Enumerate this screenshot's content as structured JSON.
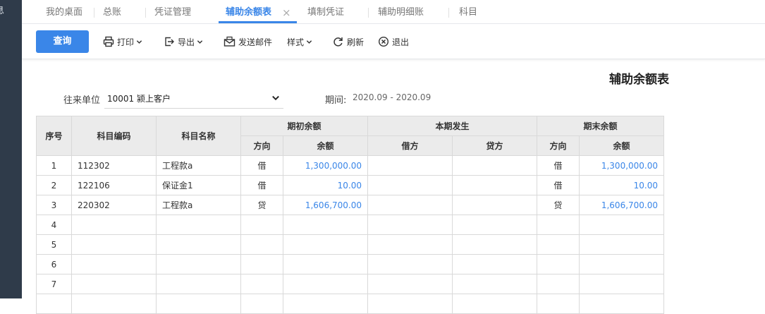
{
  "sidebar": {
    "glyph": "息"
  },
  "tabs": [
    {
      "label": "我的桌面",
      "active": false
    },
    {
      "label": "总账",
      "active": false
    },
    {
      "label": "凭证管理",
      "active": false
    },
    {
      "label": "辅助余额表",
      "active": true,
      "closable": true
    },
    {
      "label": "填制凭证",
      "active": false
    },
    {
      "label": "辅助明细账",
      "active": false
    },
    {
      "label": "科目",
      "active": false
    }
  ],
  "tab_close_glyph": "×",
  "toolbar": {
    "query_label": "查询",
    "print_label": "打印",
    "export_label": "导出",
    "email_label": "发送邮件",
    "style_label": "样式",
    "refresh_label": "刷新",
    "exit_label": "退出"
  },
  "report": {
    "title": "辅助余额表",
    "unit_label": "往来单位",
    "unit_value": "10001 颍上客户",
    "period_label": "期间:",
    "period_value": "2020.09 - 2020.09"
  },
  "table": {
    "headers": {
      "seq": "序号",
      "code": "科目编码",
      "name": "科目名称",
      "opening": "期初余额",
      "current": "本期发生",
      "closing": "期末余额",
      "direction": "方向",
      "balance": "余额",
      "debit": "借方",
      "credit": "贷方"
    },
    "rows": [
      {
        "seq": "1",
        "code": "112302",
        "name": "工程款a",
        "open_dir": "借",
        "open_bal": "1,300,000.00",
        "debit": "",
        "credit": "",
        "close_dir": "借",
        "close_bal": "1,300,000.00"
      },
      {
        "seq": "2",
        "code": "122106",
        "name": "保证金1",
        "open_dir": "借",
        "open_bal": "10.00",
        "debit": "",
        "credit": "",
        "close_dir": "借",
        "close_bal": "10.00"
      },
      {
        "seq": "3",
        "code": "220302",
        "name": "工程款a",
        "open_dir": "贷",
        "open_bal": "1,606,700.00",
        "debit": "",
        "credit": "",
        "close_dir": "贷",
        "close_bal": "1,606,700.00"
      },
      {
        "seq": "4",
        "code": "",
        "name": "",
        "open_dir": "",
        "open_bal": "",
        "debit": "",
        "credit": "",
        "close_dir": "",
        "close_bal": ""
      },
      {
        "seq": "5",
        "code": "",
        "name": "",
        "open_dir": "",
        "open_bal": "",
        "debit": "",
        "credit": "",
        "close_dir": "",
        "close_bal": ""
      },
      {
        "seq": "6",
        "code": "",
        "name": "",
        "open_dir": "",
        "open_bal": "",
        "debit": "",
        "credit": "",
        "close_dir": "",
        "close_bal": ""
      },
      {
        "seq": "7",
        "code": "",
        "name": "",
        "open_dir": "",
        "open_bal": "",
        "debit": "",
        "credit": "",
        "close_dir": "",
        "close_bal": ""
      },
      {
        "seq": "",
        "code": "",
        "name": "",
        "open_dir": "",
        "open_bal": "",
        "debit": "",
        "credit": "",
        "close_dir": "",
        "close_bal": ""
      }
    ]
  },
  "colors": {
    "accent": "#3a86e8",
    "sidebar": "#2f3b4a",
    "header_bg": "#ebebeb"
  },
  "icons": {
    "print": "printer-icon",
    "export": "export-icon",
    "email": "mail-icon",
    "refresh": "refresh-icon",
    "exit": "close-circle-icon",
    "dropdown": "chevron-down-icon"
  }
}
